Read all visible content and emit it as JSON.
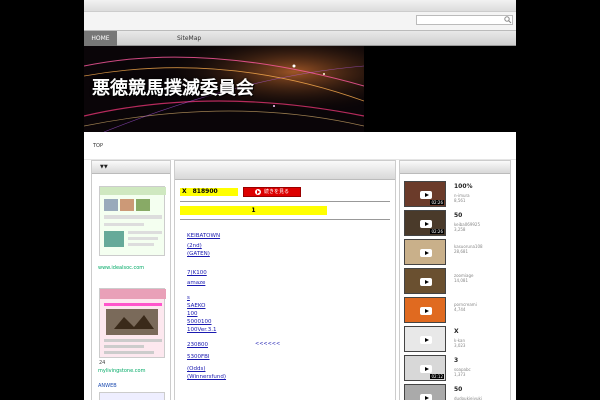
{
  "nav": {
    "home": "HOME",
    "sitemap": "SiteMap"
  },
  "header": {
    "site_title": "悪徳競馬撲滅委員会"
  },
  "breadcrumb": {
    "top": "TOP"
  },
  "left": {
    "head": "▼▼",
    "links": [
      {
        "label": "www.idealsoc.com"
      },
      {
        "caption": "24",
        "label": "mylivingstone.com"
      },
      {
        "label": "ANWEB"
      }
    ]
  },
  "center": {
    "banner1": "X　818900",
    "cta": "続きを見る",
    "banner2": "1",
    "links": [
      "KEIBATOWN",
      "(2nd)",
      "(GATEN)",
      "7(K100",
      "amaze",
      "s",
      "SAEKO",
      "100",
      "5000100",
      "100Ver.3.1",
      "230800",
      "5300FBI",
      "(Odds)",
      "(Winnersfund)"
    ],
    "marker": "<<<<<<"
  },
  "right": {
    "videos": [
      {
        "title": "100%",
        "user": "n-imura",
        "views": "8,561",
        "duration": "02:26",
        "bg": "#6b3b2a"
      },
      {
        "title": "50",
        "user": "keiba069925",
        "views": "3,258",
        "duration": "02:26",
        "bg": "#4a3a2a"
      },
      {
        "title": "",
        "user": "kasuoruna108",
        "views": "28,681",
        "duration": "",
        "bg": "#c9b08a"
      },
      {
        "title": "",
        "user": "zoomiage",
        "views": "14,081",
        "duration": "",
        "bg": "#6a5030"
      },
      {
        "title": "",
        "user": "porncreami",
        "views": "4,744",
        "duration": "",
        "bg": "#e06a20"
      },
      {
        "title": "X",
        "user": "k-kan",
        "views": "3,023",
        "duration": "",
        "bg": "#e8e8e8"
      },
      {
        "title": "3",
        "user": "soapabc",
        "views": "1,373",
        "duration": "02:12",
        "bg": "#d8d8d8"
      },
      {
        "title": "50",
        "user": "dudoukieiyuki",
        "views": "7,450",
        "duration": "",
        "bg": "#aaaaaa"
      }
    ]
  }
}
